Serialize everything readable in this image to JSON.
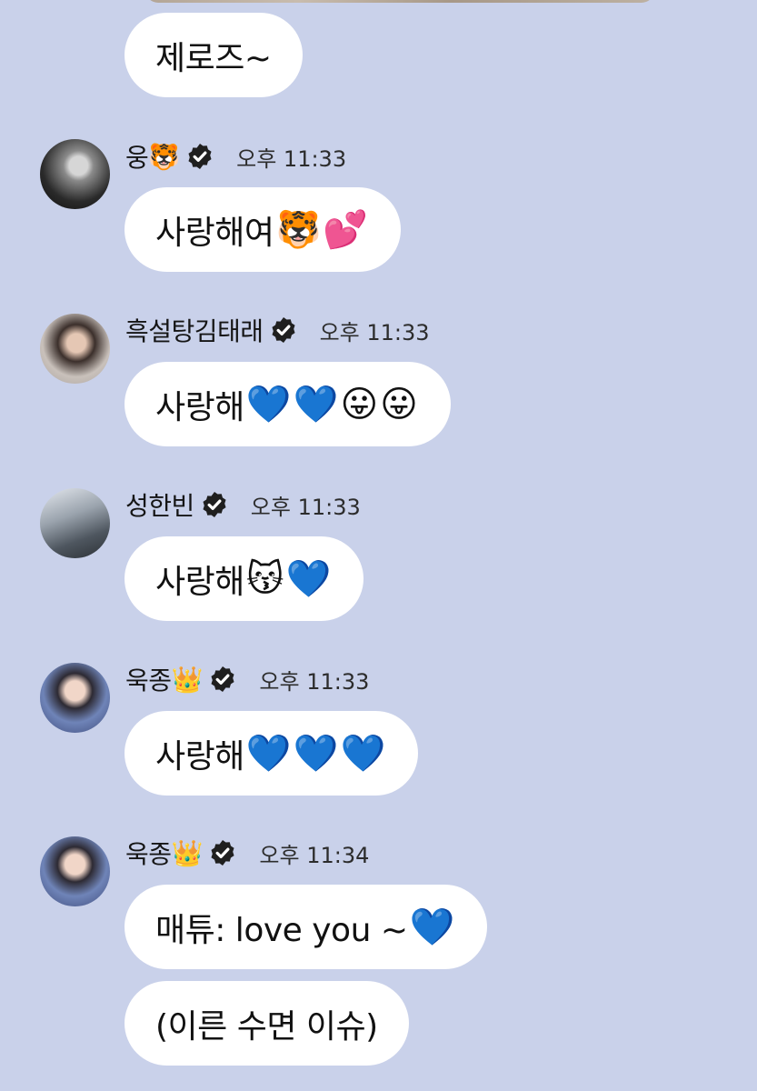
{
  "messages": [
    {
      "sender": "",
      "time": "",
      "text": "제로즈~",
      "emojis": ""
    },
    {
      "sender": "웅",
      "sender_emoji": "🐯",
      "time": "오후 11:33",
      "text": "사랑해여 ",
      "emojis": "🐯💕"
    },
    {
      "sender": "흑설탕김태래",
      "sender_emoji": "",
      "time": "오후 11:33",
      "text": "사랑해",
      "emojis": "💙💙😛😛"
    },
    {
      "sender": "성한빈",
      "sender_emoji": "",
      "time": "오후 11:33",
      "text": "사랑해",
      "emojis": "😽💙"
    },
    {
      "sender": "욱종",
      "sender_emoji": "👑",
      "time": "오후 11:33",
      "text": "사랑해",
      "emojis": "💙💙💙"
    },
    {
      "sender": "욱종",
      "sender_emoji": "👑",
      "time": "오후 11:34",
      "text": "매튜: love you ~",
      "emojis": "💙"
    },
    {
      "sender": "",
      "time": "",
      "text": "(이른 수면 이슈)",
      "emojis": ""
    }
  ],
  "icons": {
    "verified": "verified-badge-icon"
  },
  "colors": {
    "background": "#c9d1ea",
    "bubble": "#ffffff",
    "verified_badge": "#1f1f1f"
  }
}
